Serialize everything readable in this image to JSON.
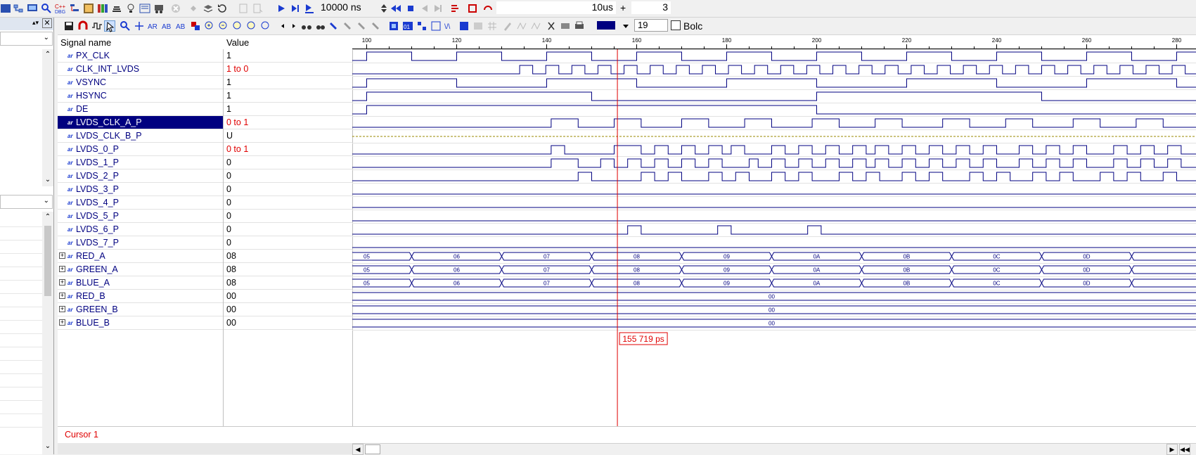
{
  "toolbar": {
    "sim_time": "10000 ns",
    "run_until": "10us",
    "step_count": "3",
    "font_size": "19",
    "bold_label": "Bolc",
    "line_color": "#000080"
  },
  "columns": {
    "name": "Signal name",
    "value": "Value"
  },
  "signals": [
    {
      "name": "PX_CLK",
      "value": "1",
      "changed": false,
      "expandable": false
    },
    {
      "name": "CLK_INT_LVDS",
      "value": "1 to 0",
      "changed": true,
      "expandable": false
    },
    {
      "name": "VSYNC",
      "value": "1",
      "changed": false,
      "expandable": false
    },
    {
      "name": "HSYNC",
      "value": "1",
      "changed": false,
      "expandable": false
    },
    {
      "name": "DE",
      "value": "1",
      "changed": false,
      "expandable": false
    },
    {
      "name": "LVDS_CLK_A_P",
      "value": "0 to 1",
      "changed": true,
      "expandable": false,
      "selected": true
    },
    {
      "name": "LVDS_CLK_B_P",
      "value": "U",
      "changed": false,
      "expandable": false
    },
    {
      "name": "LVDS_0_P",
      "value": "0 to 1",
      "changed": true,
      "expandable": false
    },
    {
      "name": "LVDS_1_P",
      "value": "0",
      "changed": false,
      "expandable": false
    },
    {
      "name": "LVDS_2_P",
      "value": "0",
      "changed": false,
      "expandable": false
    },
    {
      "name": "LVDS_3_P",
      "value": "0",
      "changed": false,
      "expandable": false
    },
    {
      "name": "LVDS_4_P",
      "value": "0",
      "changed": false,
      "expandable": false
    },
    {
      "name": "LVDS_5_P",
      "value": "0",
      "changed": false,
      "expandable": false
    },
    {
      "name": "LVDS_6_P",
      "value": "0",
      "changed": false,
      "expandable": false
    },
    {
      "name": "LVDS_7_P",
      "value": "0",
      "changed": false,
      "expandable": false
    },
    {
      "name": "RED_A",
      "value": "08",
      "changed": false,
      "expandable": true
    },
    {
      "name": "GREEN_A",
      "value": "08",
      "changed": false,
      "expandable": true
    },
    {
      "name": "BLUE_A",
      "value": "08",
      "changed": false,
      "expandable": true
    },
    {
      "name": "RED_B",
      "value": "00",
      "changed": false,
      "expandable": true
    },
    {
      "name": "GREEN_B",
      "value": "00",
      "changed": false,
      "expandable": true
    },
    {
      "name": "BLUE_B",
      "value": "00",
      "changed": false,
      "expandable": true
    }
  ],
  "time_axis": {
    "ticks": [
      "100",
      "120",
      "140",
      "160",
      "180",
      "200",
      "220",
      "240",
      "260",
      "280"
    ]
  },
  "bus_values": [
    "05",
    "06",
    "07",
    "08",
    "09",
    "0A",
    "0B",
    "0C",
    "0D",
    "0E"
  ],
  "bus_b_value": "00",
  "cursor": {
    "label": "Cursor 1",
    "time": "155 719 ps",
    "color": "#e00000"
  }
}
